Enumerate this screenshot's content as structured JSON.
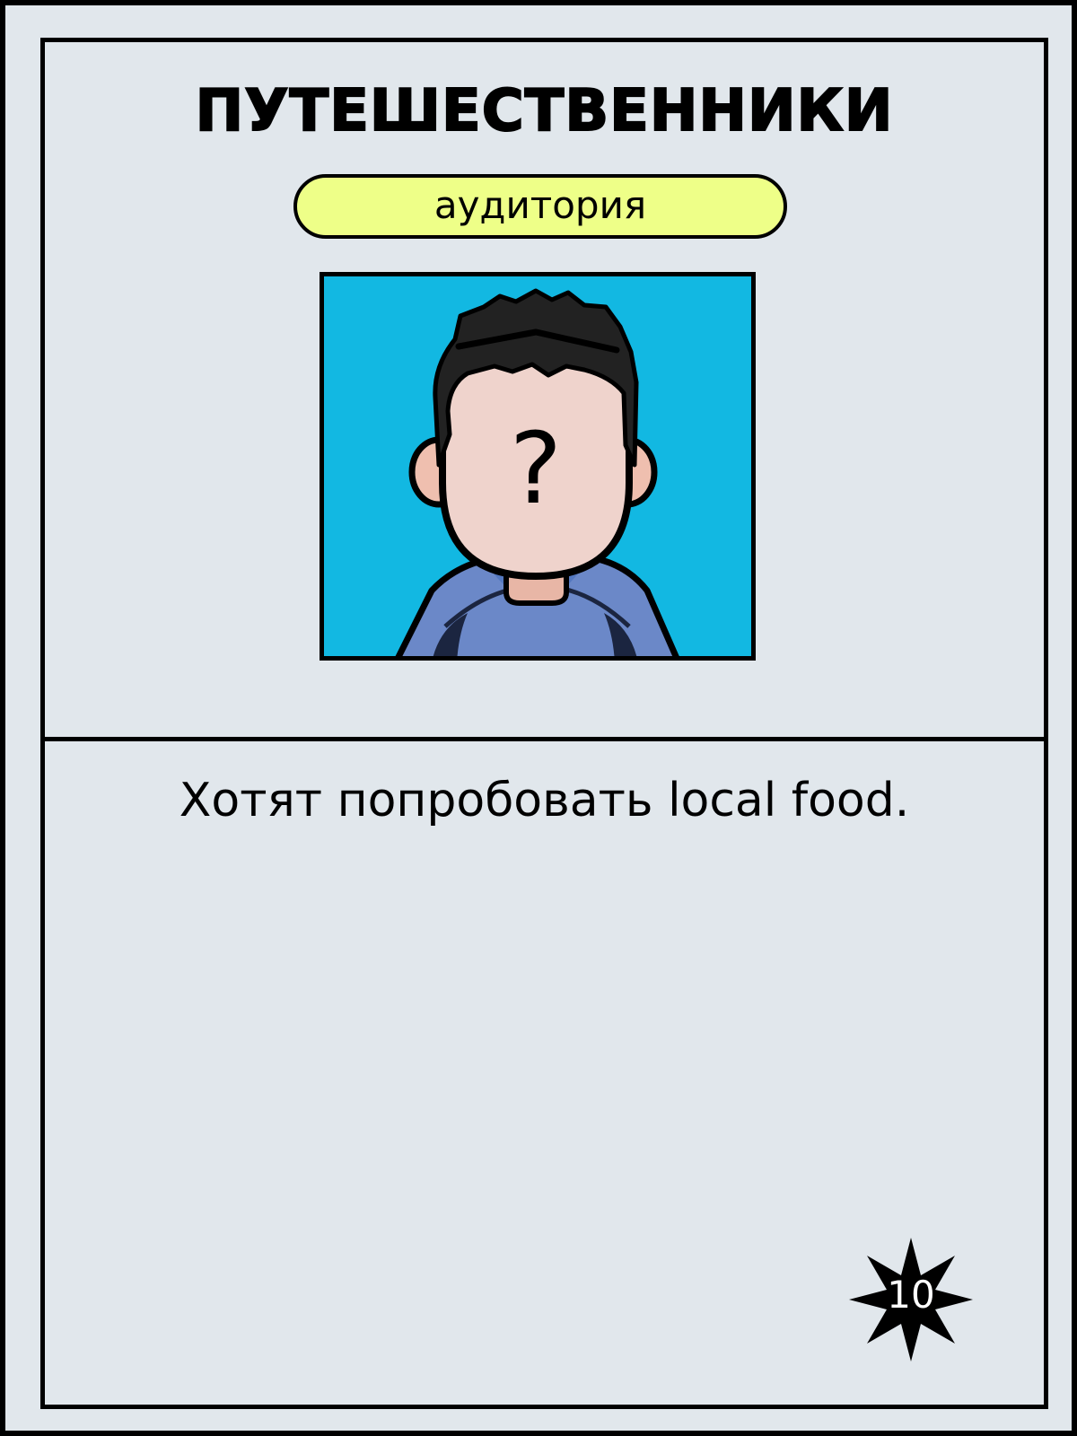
{
  "card": {
    "title": "ПУТЕШЕСТВЕННИКИ",
    "category": "аудитория",
    "description": "Хотят попробовать local food.",
    "number": "10",
    "avatar_placeholder": "?"
  },
  "colors": {
    "background": "#e1e7ec",
    "category_pill": "#eeff88",
    "avatar_background": "#12b8e2",
    "skin": "#efd3cc",
    "shirt": "#6b88c8",
    "hair": "#222222"
  },
  "icons": {
    "avatar": "person-silhouette-icon",
    "badge": "star-burst-icon"
  }
}
